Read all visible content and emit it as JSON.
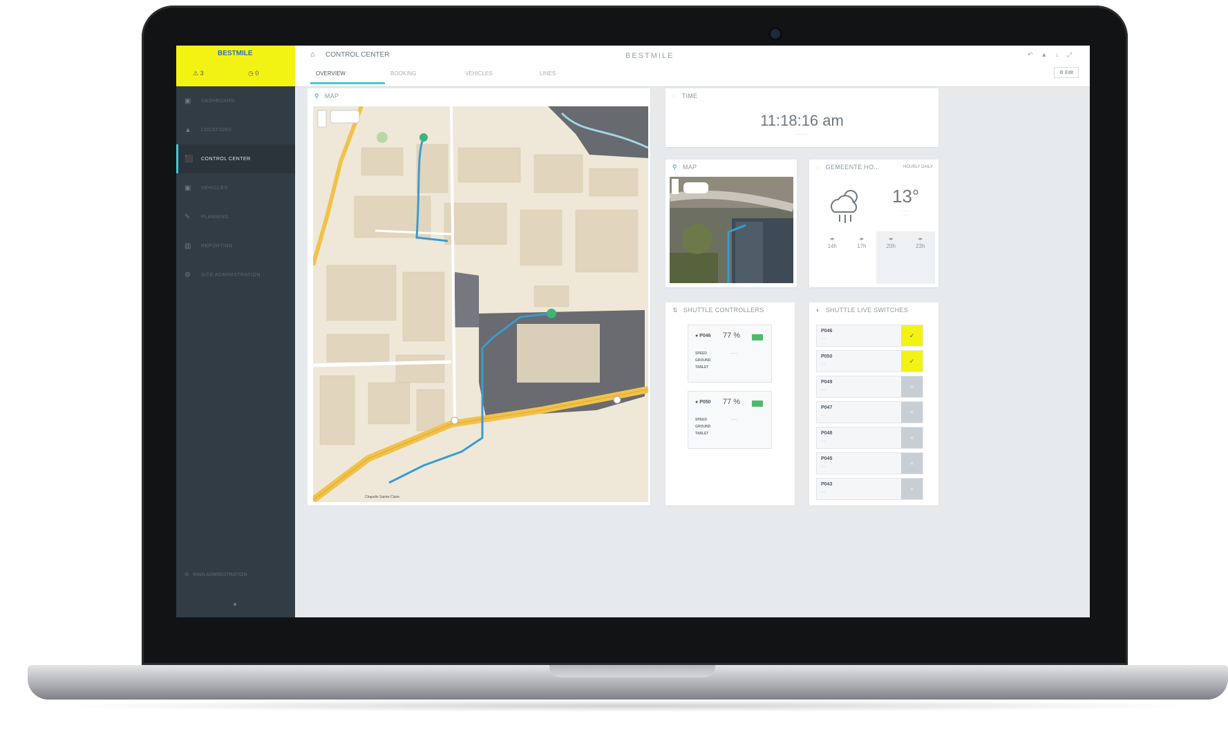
{
  "sidebar": {
    "logo": "BESTMILE",
    "stats": [
      "3",
      "0"
    ],
    "items": [
      {
        "label": "DASHBOARD",
        "icon": "dashboard-icon"
      },
      {
        "label": "LOCATIONS",
        "icon": "location-icon"
      },
      {
        "label": "CONTROL CENTER",
        "icon": "car-icon"
      },
      {
        "label": "VEHICLES",
        "icon": "vehicle-icon"
      },
      {
        "label": "PLANNING",
        "icon": "pencil-icon"
      },
      {
        "label": "REPORTING",
        "icon": "chart-icon"
      },
      {
        "label": "SITE ADMINISTRATION",
        "icon": "settings-icon"
      }
    ],
    "bottom": "MAIN ADMINISTRATION"
  },
  "topbar": {
    "title": "CONTROL CENTER",
    "brand": "BESTMILE",
    "tabs": [
      "OVERVIEW",
      "BOOKING",
      "VEHICLES",
      "LINES"
    ],
    "active_tab": "OVERVIEW",
    "edit_label": "Edit"
  },
  "map": {
    "title": "MAP",
    "street_label": "Chapelle Sainte-Claire"
  },
  "time": {
    "title": "TIME",
    "value": "11:18:16 am"
  },
  "minimap": {
    "title": "MAP"
  },
  "weather": {
    "title": "GEMEENTE HO...",
    "tabs": "HOURLY  DAILY",
    "temperature": "13°",
    "hours": [
      "14h",
      "17h",
      "20h",
      "23h"
    ]
  },
  "shuttle_controllers": {
    "title": "SHUTTLE CONTROLLERS",
    "items": [
      {
        "id": "P046",
        "battery": "77 %",
        "rows": [
          "SPEED",
          "GROUND",
          "TABLET"
        ]
      },
      {
        "id": "P050",
        "battery": "77 %",
        "rows": [
          "SPEED",
          "GROUND",
          "TABLET"
        ]
      }
    ]
  },
  "switches": {
    "title": "SHUTTLE LIVE SWITCHES",
    "items": [
      {
        "id": "P046",
        "on": true
      },
      {
        "id": "P050",
        "on": true
      },
      {
        "id": "P049",
        "on": false
      },
      {
        "id": "P047",
        "on": false
      },
      {
        "id": "P048",
        "on": false
      },
      {
        "id": "P045",
        "on": false
      },
      {
        "id": "P043",
        "on": false
      }
    ],
    "on_symbol": "✓",
    "off_symbol": "×"
  }
}
